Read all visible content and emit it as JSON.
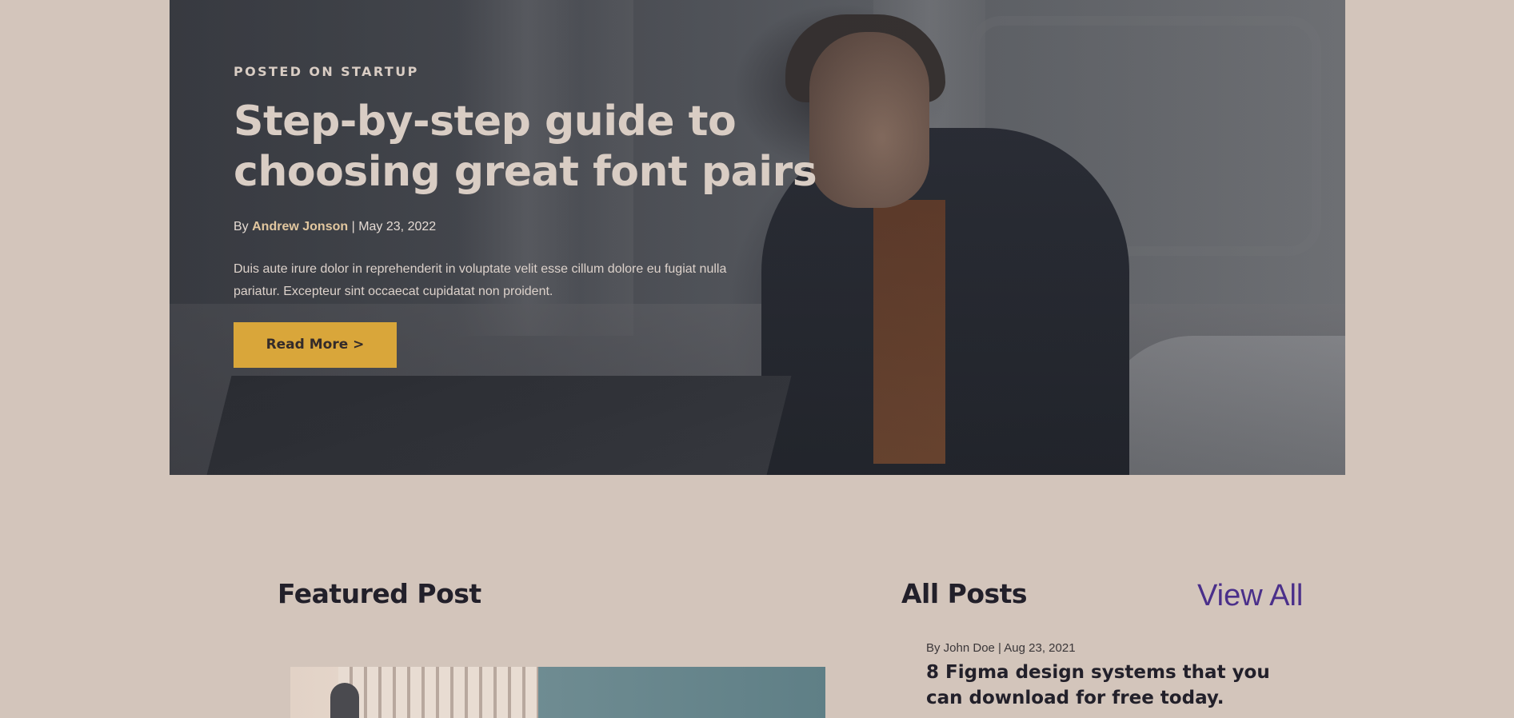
{
  "hero": {
    "category_label": "POSTED ON STARTUP",
    "title": "Step-by-step guide to choosing great font pairs",
    "by_prefix": "By",
    "author": "Andrew Jonson",
    "separator": "|",
    "date": "May 23, 2022",
    "excerpt": "Duis aute irure dolor in reprehenderit in voluptate velit esse cillum dolore eu fugiat nulla pariatur. Excepteur sint occaecat cupidatat non proident.",
    "read_more_label": "Read More >",
    "button_color": "#d9a63a",
    "author_color": "#e2c79f"
  },
  "featured": {
    "heading": "Featured Post"
  },
  "all_posts": {
    "heading": "All Posts",
    "view_all_label": "View All",
    "view_all_color": "#4a2f8a",
    "items": [
      {
        "meta": "By John Doe | Aug 23, 2021",
        "title": "8 Figma design systems that you can download for free today."
      }
    ]
  },
  "colors": {
    "page_background": "#d3c5bb",
    "heading_text": "#22202a"
  }
}
